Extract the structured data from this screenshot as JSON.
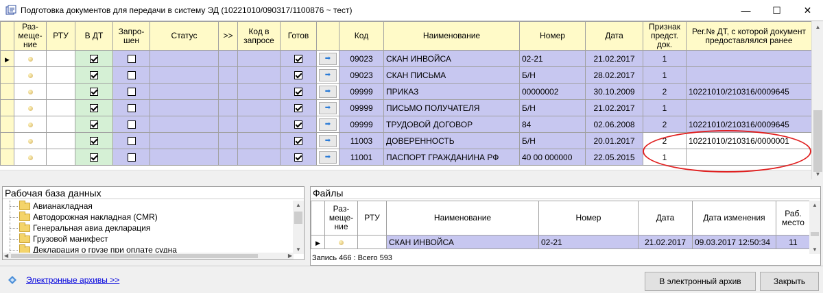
{
  "window": {
    "title": "Подготовка документов для передачи в систему ЭД (10221010/090317/1100876 ~ тест)",
    "minimize": "—",
    "maximize": "☐",
    "close": "✕"
  },
  "grid": {
    "headers": {
      "placement": "Раз-\nмеще-\nние",
      "rtu": "РТУ",
      "in_dt": "В ДТ",
      "requested": "Запро-\nшен",
      "status": "Статус",
      "more": ">>",
      "code_in_request": "Код в запросе",
      "ready": "Готов",
      "code": "Код",
      "name": "Наименование",
      "number": "Номер",
      "date": "Дата",
      "sign": "Признак предст. док.",
      "prev_reg": "Рег.№ ДТ, с которой документ предоставлялся ранее"
    },
    "rows": [
      {
        "code": "09023",
        "name": "СКАН ИНВОЙСА",
        "number": "02-21",
        "date": "21.02.2017",
        "sign": "1",
        "reg": "",
        "current": true
      },
      {
        "code": "09023",
        "name": "СКАН ПИСЬМА",
        "number": "Б/Н",
        "date": "28.02.2017",
        "sign": "1",
        "reg": "",
        "current": false
      },
      {
        "code": "09999",
        "name": "ПРИКАЗ",
        "number": "00000002",
        "date": "30.10.2009",
        "sign": "2",
        "reg": "10221010/210316/0009645",
        "current": false
      },
      {
        "code": "09999",
        "name": "ПИСЬМО ПОЛУЧАТЕЛЯ",
        "number": "Б/Н",
        "date": "21.02.2017",
        "sign": "1",
        "reg": "",
        "current": false
      },
      {
        "code": "09999",
        "name": "ТРУДОВОЙ ДОГОВОР",
        "number": "84",
        "date": "02.06.2008",
        "sign": "2",
        "reg": "10221010/210316/0009645",
        "current": false
      },
      {
        "code": "11003",
        "name": "ДОВЕРЕННОСТЬ",
        "number": "Б/Н",
        "date": "20.01.2017",
        "sign": "2",
        "reg": "10221010/210316/0000001",
        "current": false
      },
      {
        "code": "11001",
        "name": "ПАСПОРТ ГРАЖДАНИНА РФ",
        "number": "40 00 000000",
        "date": "22.05.2015",
        "sign": "1",
        "reg": "",
        "current": false
      }
    ]
  },
  "db_panel": {
    "title": "Рабочая база данных",
    "items": [
      "Авианакладная",
      "Автодорожная накладная (CMR)",
      "Генеральная авиа декларация",
      "Грузовой манифест",
      "Декларация о грузе при оплате судна"
    ]
  },
  "files_panel": {
    "title": "Файлы",
    "headers": {
      "placement": "Раз-\nмеще-\nние",
      "rtu": "РТУ",
      "name": "Наименование",
      "number": "Номер",
      "date": "Дата",
      "modified": "Дата изменения",
      "workplace": "Раб. место"
    },
    "rows": [
      {
        "name": "СКАН ИНВОЙСА",
        "number": "02-21",
        "date": "21.02.2017",
        "modified": "09.03.2017 12:50:34",
        "workplace": "11"
      }
    ],
    "status": "Запись 466 : Всего 593"
  },
  "footer": {
    "link": "Электронные архивы >>",
    "archive_button": "В электронный архив",
    "close_button": "Закрыть"
  }
}
